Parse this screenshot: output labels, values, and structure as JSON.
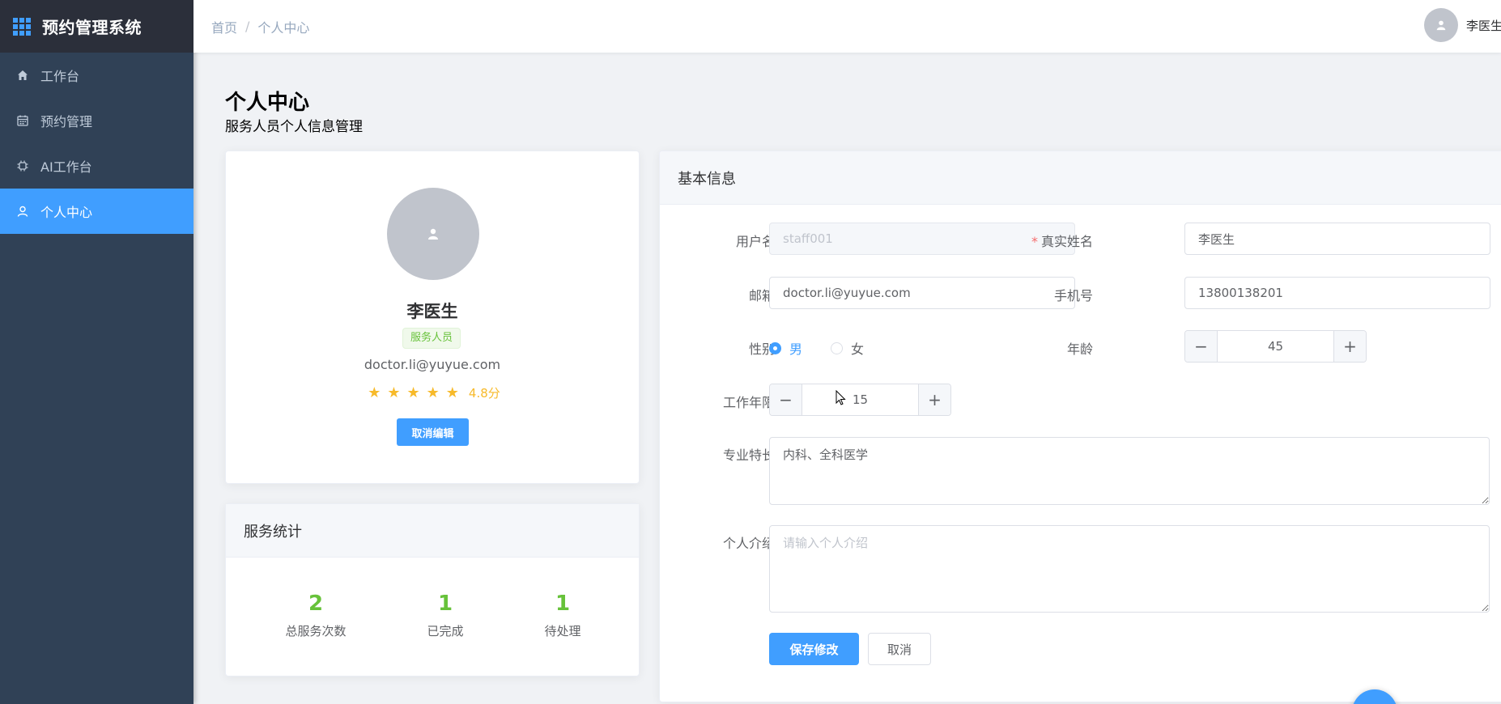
{
  "brand": {
    "title": "预约管理系统",
    "icon": "grid-icon",
    "accent": "#409eff"
  },
  "sidebar": {
    "items": [
      {
        "label": "工作台",
        "icon": "home-icon",
        "active": false
      },
      {
        "label": "预约管理",
        "icon": "calendar-icon",
        "active": false
      },
      {
        "label": "AI工作台",
        "icon": "chip-icon",
        "active": false
      },
      {
        "label": "个人中心",
        "icon": "user-icon",
        "active": true
      }
    ]
  },
  "header": {
    "breadcrumb": [
      "首页",
      "个人中心"
    ],
    "separator": "/",
    "username": "李医生"
  },
  "page": {
    "title": "个人中心",
    "subtitle": "服务人员个人信息管理"
  },
  "profile": {
    "name": "李医生",
    "role": "服务人员",
    "email": "doctor.li@yuyue.com",
    "rating_stars": 5,
    "rating_text": "4.8分",
    "edit_button": "取消编辑"
  },
  "stats": {
    "title": "服务统计",
    "items": [
      {
        "value": "2",
        "label": "总服务次数"
      },
      {
        "value": "1",
        "label": "已完成"
      },
      {
        "value": "1",
        "label": "待处理"
      }
    ]
  },
  "form": {
    "title": "基本信息",
    "username": {
      "label": "用户名",
      "value": "staff001"
    },
    "realname": {
      "label": "真实姓名",
      "value": "李医生",
      "required_mark": "*"
    },
    "email": {
      "label": "邮箱",
      "value": "doctor.li@yuyue.com"
    },
    "phone": {
      "label": "手机号",
      "value": "13800138201"
    },
    "gender": {
      "label": "性别",
      "options": [
        "男",
        "女"
      ],
      "selected": "男"
    },
    "age": {
      "label": "年龄",
      "value": "45"
    },
    "years": {
      "label": "工作年限",
      "value": "15"
    },
    "specialty": {
      "label": "专业特长",
      "value": "内科、全科医学"
    },
    "intro": {
      "label": "个人介绍",
      "placeholder": "请输入个人介绍"
    },
    "save_button": "保存修改",
    "cancel_button": "取消"
  }
}
